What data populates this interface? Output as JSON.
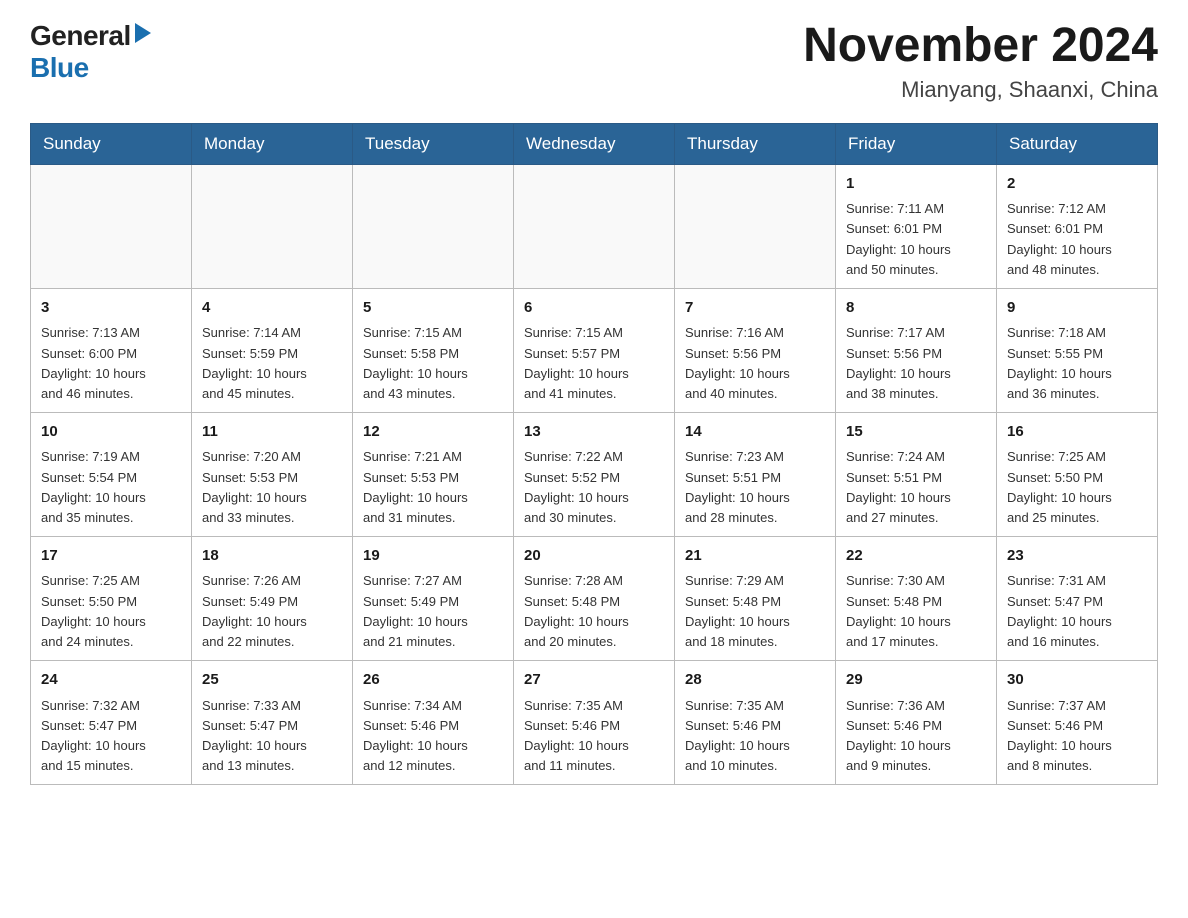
{
  "header": {
    "logo_general": "General",
    "logo_blue": "Blue",
    "month_title": "November 2024",
    "location": "Mianyang, Shaanxi, China"
  },
  "weekdays": [
    "Sunday",
    "Monday",
    "Tuesday",
    "Wednesday",
    "Thursday",
    "Friday",
    "Saturday"
  ],
  "weeks": [
    [
      {
        "day": "",
        "info": ""
      },
      {
        "day": "",
        "info": ""
      },
      {
        "day": "",
        "info": ""
      },
      {
        "day": "",
        "info": ""
      },
      {
        "day": "",
        "info": ""
      },
      {
        "day": "1",
        "info": "Sunrise: 7:11 AM\nSunset: 6:01 PM\nDaylight: 10 hours\nand 50 minutes."
      },
      {
        "day": "2",
        "info": "Sunrise: 7:12 AM\nSunset: 6:01 PM\nDaylight: 10 hours\nand 48 minutes."
      }
    ],
    [
      {
        "day": "3",
        "info": "Sunrise: 7:13 AM\nSunset: 6:00 PM\nDaylight: 10 hours\nand 46 minutes."
      },
      {
        "day": "4",
        "info": "Sunrise: 7:14 AM\nSunset: 5:59 PM\nDaylight: 10 hours\nand 45 minutes."
      },
      {
        "day": "5",
        "info": "Sunrise: 7:15 AM\nSunset: 5:58 PM\nDaylight: 10 hours\nand 43 minutes."
      },
      {
        "day": "6",
        "info": "Sunrise: 7:15 AM\nSunset: 5:57 PM\nDaylight: 10 hours\nand 41 minutes."
      },
      {
        "day": "7",
        "info": "Sunrise: 7:16 AM\nSunset: 5:56 PM\nDaylight: 10 hours\nand 40 minutes."
      },
      {
        "day": "8",
        "info": "Sunrise: 7:17 AM\nSunset: 5:56 PM\nDaylight: 10 hours\nand 38 minutes."
      },
      {
        "day": "9",
        "info": "Sunrise: 7:18 AM\nSunset: 5:55 PM\nDaylight: 10 hours\nand 36 minutes."
      }
    ],
    [
      {
        "day": "10",
        "info": "Sunrise: 7:19 AM\nSunset: 5:54 PM\nDaylight: 10 hours\nand 35 minutes."
      },
      {
        "day": "11",
        "info": "Sunrise: 7:20 AM\nSunset: 5:53 PM\nDaylight: 10 hours\nand 33 minutes."
      },
      {
        "day": "12",
        "info": "Sunrise: 7:21 AM\nSunset: 5:53 PM\nDaylight: 10 hours\nand 31 minutes."
      },
      {
        "day": "13",
        "info": "Sunrise: 7:22 AM\nSunset: 5:52 PM\nDaylight: 10 hours\nand 30 minutes."
      },
      {
        "day": "14",
        "info": "Sunrise: 7:23 AM\nSunset: 5:51 PM\nDaylight: 10 hours\nand 28 minutes."
      },
      {
        "day": "15",
        "info": "Sunrise: 7:24 AM\nSunset: 5:51 PM\nDaylight: 10 hours\nand 27 minutes."
      },
      {
        "day": "16",
        "info": "Sunrise: 7:25 AM\nSunset: 5:50 PM\nDaylight: 10 hours\nand 25 minutes."
      }
    ],
    [
      {
        "day": "17",
        "info": "Sunrise: 7:25 AM\nSunset: 5:50 PM\nDaylight: 10 hours\nand 24 minutes."
      },
      {
        "day": "18",
        "info": "Sunrise: 7:26 AM\nSunset: 5:49 PM\nDaylight: 10 hours\nand 22 minutes."
      },
      {
        "day": "19",
        "info": "Sunrise: 7:27 AM\nSunset: 5:49 PM\nDaylight: 10 hours\nand 21 minutes."
      },
      {
        "day": "20",
        "info": "Sunrise: 7:28 AM\nSunset: 5:48 PM\nDaylight: 10 hours\nand 20 minutes."
      },
      {
        "day": "21",
        "info": "Sunrise: 7:29 AM\nSunset: 5:48 PM\nDaylight: 10 hours\nand 18 minutes."
      },
      {
        "day": "22",
        "info": "Sunrise: 7:30 AM\nSunset: 5:48 PM\nDaylight: 10 hours\nand 17 minutes."
      },
      {
        "day": "23",
        "info": "Sunrise: 7:31 AM\nSunset: 5:47 PM\nDaylight: 10 hours\nand 16 minutes."
      }
    ],
    [
      {
        "day": "24",
        "info": "Sunrise: 7:32 AM\nSunset: 5:47 PM\nDaylight: 10 hours\nand 15 minutes."
      },
      {
        "day": "25",
        "info": "Sunrise: 7:33 AM\nSunset: 5:47 PM\nDaylight: 10 hours\nand 13 minutes."
      },
      {
        "day": "26",
        "info": "Sunrise: 7:34 AM\nSunset: 5:46 PM\nDaylight: 10 hours\nand 12 minutes."
      },
      {
        "day": "27",
        "info": "Sunrise: 7:35 AM\nSunset: 5:46 PM\nDaylight: 10 hours\nand 11 minutes."
      },
      {
        "day": "28",
        "info": "Sunrise: 7:35 AM\nSunset: 5:46 PM\nDaylight: 10 hours\nand 10 minutes."
      },
      {
        "day": "29",
        "info": "Sunrise: 7:36 AM\nSunset: 5:46 PM\nDaylight: 10 hours\nand 9 minutes."
      },
      {
        "day": "30",
        "info": "Sunrise: 7:37 AM\nSunset: 5:46 PM\nDaylight: 10 hours\nand 8 minutes."
      }
    ]
  ]
}
